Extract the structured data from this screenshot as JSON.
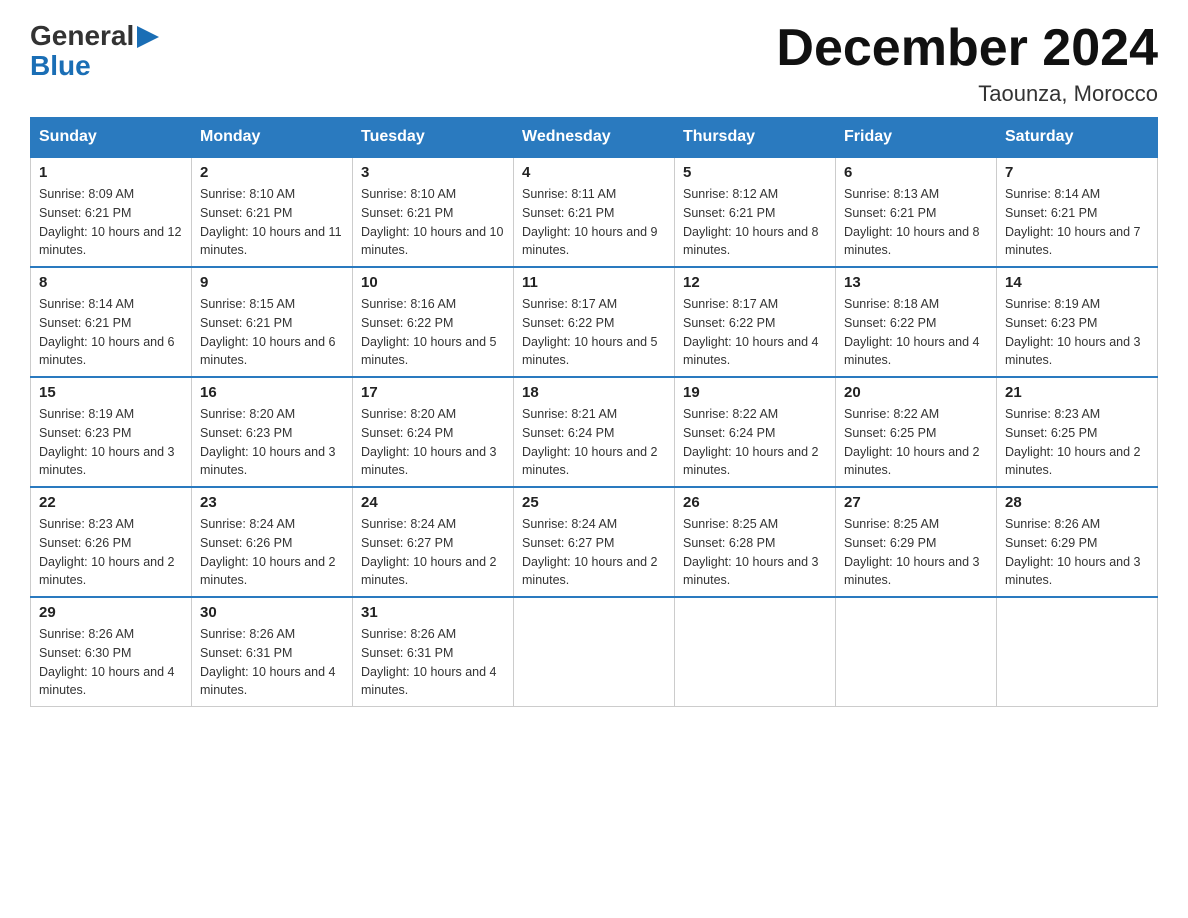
{
  "logo": {
    "general": "General",
    "blue": "Blue",
    "arrow": "▶"
  },
  "title": "December 2024",
  "subtitle": "Taounza, Morocco",
  "days_of_week": [
    "Sunday",
    "Monday",
    "Tuesday",
    "Wednesday",
    "Thursday",
    "Friday",
    "Saturday"
  ],
  "weeks": [
    [
      {
        "day": "1",
        "sunrise": "8:09 AM",
        "sunset": "6:21 PM",
        "daylight": "10 hours and 12 minutes."
      },
      {
        "day": "2",
        "sunrise": "8:10 AM",
        "sunset": "6:21 PM",
        "daylight": "10 hours and 11 minutes."
      },
      {
        "day": "3",
        "sunrise": "8:10 AM",
        "sunset": "6:21 PM",
        "daylight": "10 hours and 10 minutes."
      },
      {
        "day": "4",
        "sunrise": "8:11 AM",
        "sunset": "6:21 PM",
        "daylight": "10 hours and 9 minutes."
      },
      {
        "day": "5",
        "sunrise": "8:12 AM",
        "sunset": "6:21 PM",
        "daylight": "10 hours and 8 minutes."
      },
      {
        "day": "6",
        "sunrise": "8:13 AM",
        "sunset": "6:21 PM",
        "daylight": "10 hours and 8 minutes."
      },
      {
        "day": "7",
        "sunrise": "8:14 AM",
        "sunset": "6:21 PM",
        "daylight": "10 hours and 7 minutes."
      }
    ],
    [
      {
        "day": "8",
        "sunrise": "8:14 AM",
        "sunset": "6:21 PM",
        "daylight": "10 hours and 6 minutes."
      },
      {
        "day": "9",
        "sunrise": "8:15 AM",
        "sunset": "6:21 PM",
        "daylight": "10 hours and 6 minutes."
      },
      {
        "day": "10",
        "sunrise": "8:16 AM",
        "sunset": "6:22 PM",
        "daylight": "10 hours and 5 minutes."
      },
      {
        "day": "11",
        "sunrise": "8:17 AM",
        "sunset": "6:22 PM",
        "daylight": "10 hours and 5 minutes."
      },
      {
        "day": "12",
        "sunrise": "8:17 AM",
        "sunset": "6:22 PM",
        "daylight": "10 hours and 4 minutes."
      },
      {
        "day": "13",
        "sunrise": "8:18 AM",
        "sunset": "6:22 PM",
        "daylight": "10 hours and 4 minutes."
      },
      {
        "day": "14",
        "sunrise": "8:19 AM",
        "sunset": "6:23 PM",
        "daylight": "10 hours and 3 minutes."
      }
    ],
    [
      {
        "day": "15",
        "sunrise": "8:19 AM",
        "sunset": "6:23 PM",
        "daylight": "10 hours and 3 minutes."
      },
      {
        "day": "16",
        "sunrise": "8:20 AM",
        "sunset": "6:23 PM",
        "daylight": "10 hours and 3 minutes."
      },
      {
        "day": "17",
        "sunrise": "8:20 AM",
        "sunset": "6:24 PM",
        "daylight": "10 hours and 3 minutes."
      },
      {
        "day": "18",
        "sunrise": "8:21 AM",
        "sunset": "6:24 PM",
        "daylight": "10 hours and 2 minutes."
      },
      {
        "day": "19",
        "sunrise": "8:22 AM",
        "sunset": "6:24 PM",
        "daylight": "10 hours and 2 minutes."
      },
      {
        "day": "20",
        "sunrise": "8:22 AM",
        "sunset": "6:25 PM",
        "daylight": "10 hours and 2 minutes."
      },
      {
        "day": "21",
        "sunrise": "8:23 AM",
        "sunset": "6:25 PM",
        "daylight": "10 hours and 2 minutes."
      }
    ],
    [
      {
        "day": "22",
        "sunrise": "8:23 AM",
        "sunset": "6:26 PM",
        "daylight": "10 hours and 2 minutes."
      },
      {
        "day": "23",
        "sunrise": "8:24 AM",
        "sunset": "6:26 PM",
        "daylight": "10 hours and 2 minutes."
      },
      {
        "day": "24",
        "sunrise": "8:24 AM",
        "sunset": "6:27 PM",
        "daylight": "10 hours and 2 minutes."
      },
      {
        "day": "25",
        "sunrise": "8:24 AM",
        "sunset": "6:27 PM",
        "daylight": "10 hours and 2 minutes."
      },
      {
        "day": "26",
        "sunrise": "8:25 AM",
        "sunset": "6:28 PM",
        "daylight": "10 hours and 3 minutes."
      },
      {
        "day": "27",
        "sunrise": "8:25 AM",
        "sunset": "6:29 PM",
        "daylight": "10 hours and 3 minutes."
      },
      {
        "day": "28",
        "sunrise": "8:26 AM",
        "sunset": "6:29 PM",
        "daylight": "10 hours and 3 minutes."
      }
    ],
    [
      {
        "day": "29",
        "sunrise": "8:26 AM",
        "sunset": "6:30 PM",
        "daylight": "10 hours and 4 minutes."
      },
      {
        "day": "30",
        "sunrise": "8:26 AM",
        "sunset": "6:31 PM",
        "daylight": "10 hours and 4 minutes."
      },
      {
        "day": "31",
        "sunrise": "8:26 AM",
        "sunset": "6:31 PM",
        "daylight": "10 hours and 4 minutes."
      },
      null,
      null,
      null,
      null
    ]
  ]
}
